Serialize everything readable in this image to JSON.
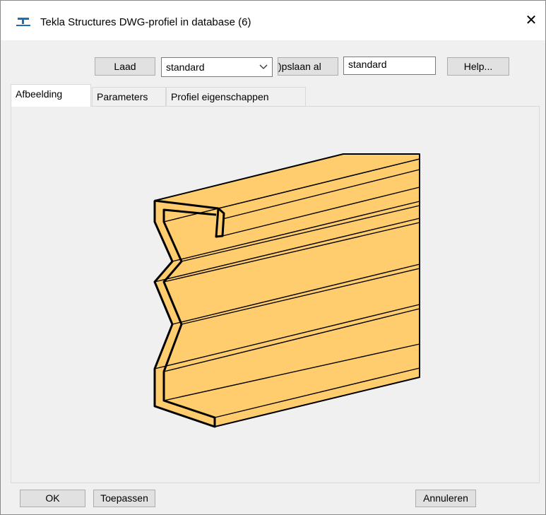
{
  "window": {
    "title": "Tekla Structures  DWG-profiel in database (6)",
    "close_label": "✕"
  },
  "toolbar": {
    "load_label": "Laad",
    "load_select_value": "standard",
    "save_as_label": ")pslaan al",
    "save_as_value": "standard",
    "help_label": "Help..."
  },
  "tabs": [
    {
      "label": "Afbeelding",
      "active": true
    },
    {
      "label": "Parameters",
      "active": false
    },
    {
      "label": "Profiel eigenschappen",
      "active": false
    }
  ],
  "preview": {
    "fill_color": "#ffcc6e",
    "line_color": "#000000"
  },
  "footer": {
    "ok_label": "OK",
    "apply_label": "Toepassen",
    "cancel_label": "Annuleren"
  }
}
